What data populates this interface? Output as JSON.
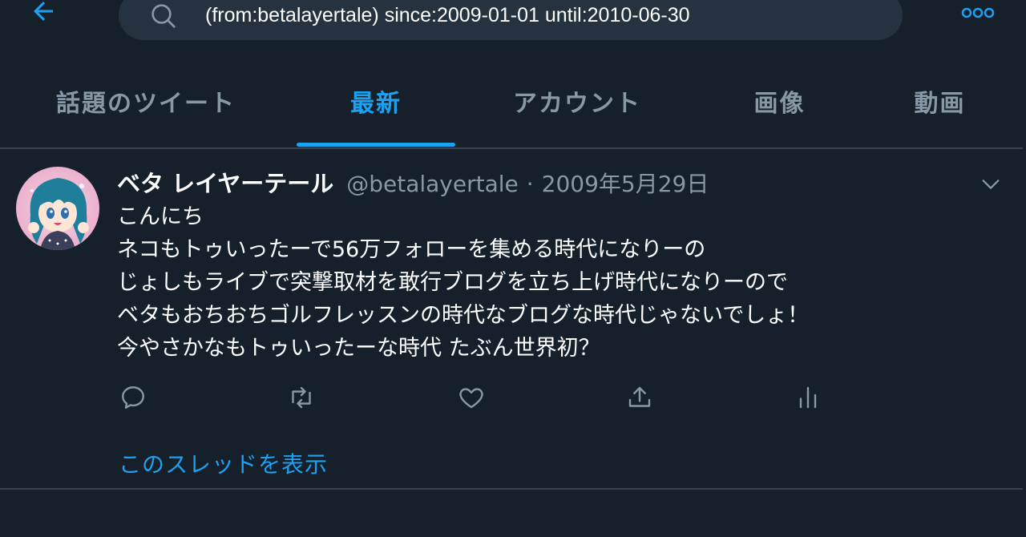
{
  "search": {
    "query": "(from:betalayertale) since:2009-01-01 until:2010-06-30"
  },
  "tabs": [
    {
      "label": "話題のツイート"
    },
    {
      "label": "最新"
    },
    {
      "label": "アカウント"
    },
    {
      "label": "画像"
    },
    {
      "label": "動画"
    }
  ],
  "active_tab": "最新",
  "tweet": {
    "display_name": "ベタ レイヤーテール",
    "handle": "@betalayertale",
    "separator": "·",
    "date": "2009年5月29日",
    "lines": [
      "こんにち",
      "ネコもトゥいったーで56万フォローを集める時代になりーの",
      "じょしもライブで突撃取材を敢行ブログを立ち上げ時代になりーので",
      "ベタもおちおちゴルフレッスンの時代なブログな時代じゃないでしょ！",
      "今やさかなもトゥいったーな時代 たぶん世界初？"
    ],
    "thread_link": "このスレッドを表示"
  },
  "colors": {
    "background": "#15202b",
    "accent": "#1da1f2",
    "muted": "#8899a6",
    "search_bg": "#253341",
    "divider": "#38444d"
  },
  "icons": {
    "back": "arrow-left-icon",
    "search": "search-icon",
    "more": "more-dots-icon",
    "caret": "chevron-down-icon",
    "reply": "reply-icon",
    "retweet": "retweet-icon",
    "like": "heart-icon",
    "share": "share-icon",
    "analytics": "analytics-icon"
  }
}
